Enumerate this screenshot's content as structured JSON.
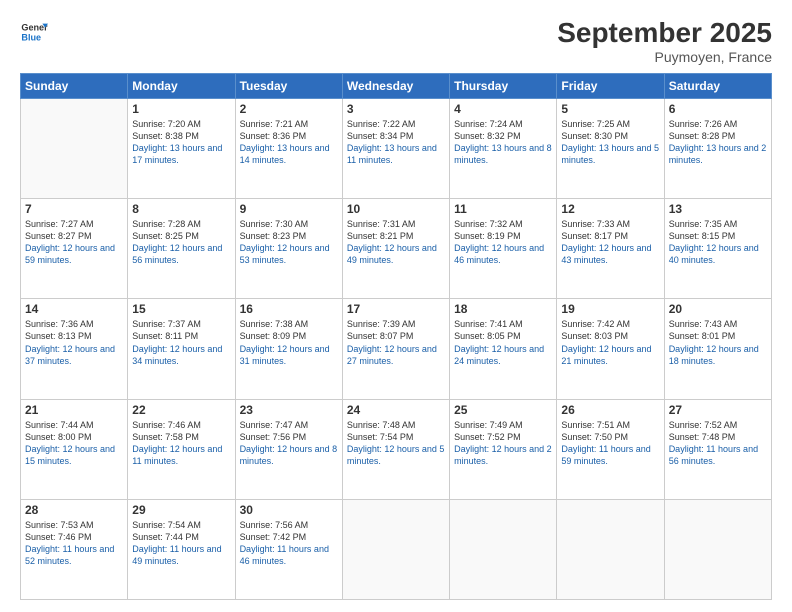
{
  "logo": {
    "line1": "General",
    "line2": "Blue"
  },
  "header": {
    "month": "September 2025",
    "location": "Puymoyen, France"
  },
  "days_of_week": [
    "Sunday",
    "Monday",
    "Tuesday",
    "Wednesday",
    "Thursday",
    "Friday",
    "Saturday"
  ],
  "weeks": [
    [
      {
        "day": "",
        "sunrise": "",
        "sunset": "",
        "daylight": ""
      },
      {
        "day": "1",
        "sunrise": "Sunrise: 7:20 AM",
        "sunset": "Sunset: 8:38 PM",
        "daylight": "Daylight: 13 hours and 17 minutes."
      },
      {
        "day": "2",
        "sunrise": "Sunrise: 7:21 AM",
        "sunset": "Sunset: 8:36 PM",
        "daylight": "Daylight: 13 hours and 14 minutes."
      },
      {
        "day": "3",
        "sunrise": "Sunrise: 7:22 AM",
        "sunset": "Sunset: 8:34 PM",
        "daylight": "Daylight: 13 hours and 11 minutes."
      },
      {
        "day": "4",
        "sunrise": "Sunrise: 7:24 AM",
        "sunset": "Sunset: 8:32 PM",
        "daylight": "Daylight: 13 hours and 8 minutes."
      },
      {
        "day": "5",
        "sunrise": "Sunrise: 7:25 AM",
        "sunset": "Sunset: 8:30 PM",
        "daylight": "Daylight: 13 hours and 5 minutes."
      },
      {
        "day": "6",
        "sunrise": "Sunrise: 7:26 AM",
        "sunset": "Sunset: 8:28 PM",
        "daylight": "Daylight: 13 hours and 2 minutes."
      }
    ],
    [
      {
        "day": "7",
        "sunrise": "Sunrise: 7:27 AM",
        "sunset": "Sunset: 8:27 PM",
        "daylight": "Daylight: 12 hours and 59 minutes."
      },
      {
        "day": "8",
        "sunrise": "Sunrise: 7:28 AM",
        "sunset": "Sunset: 8:25 PM",
        "daylight": "Daylight: 12 hours and 56 minutes."
      },
      {
        "day": "9",
        "sunrise": "Sunrise: 7:30 AM",
        "sunset": "Sunset: 8:23 PM",
        "daylight": "Daylight: 12 hours and 53 minutes."
      },
      {
        "day": "10",
        "sunrise": "Sunrise: 7:31 AM",
        "sunset": "Sunset: 8:21 PM",
        "daylight": "Daylight: 12 hours and 49 minutes."
      },
      {
        "day": "11",
        "sunrise": "Sunrise: 7:32 AM",
        "sunset": "Sunset: 8:19 PM",
        "daylight": "Daylight: 12 hours and 46 minutes."
      },
      {
        "day": "12",
        "sunrise": "Sunrise: 7:33 AM",
        "sunset": "Sunset: 8:17 PM",
        "daylight": "Daylight: 12 hours and 43 minutes."
      },
      {
        "day": "13",
        "sunrise": "Sunrise: 7:35 AM",
        "sunset": "Sunset: 8:15 PM",
        "daylight": "Daylight: 12 hours and 40 minutes."
      }
    ],
    [
      {
        "day": "14",
        "sunrise": "Sunrise: 7:36 AM",
        "sunset": "Sunset: 8:13 PM",
        "daylight": "Daylight: 12 hours and 37 minutes."
      },
      {
        "day": "15",
        "sunrise": "Sunrise: 7:37 AM",
        "sunset": "Sunset: 8:11 PM",
        "daylight": "Daylight: 12 hours and 34 minutes."
      },
      {
        "day": "16",
        "sunrise": "Sunrise: 7:38 AM",
        "sunset": "Sunset: 8:09 PM",
        "daylight": "Daylight: 12 hours and 31 minutes."
      },
      {
        "day": "17",
        "sunrise": "Sunrise: 7:39 AM",
        "sunset": "Sunset: 8:07 PM",
        "daylight": "Daylight: 12 hours and 27 minutes."
      },
      {
        "day": "18",
        "sunrise": "Sunrise: 7:41 AM",
        "sunset": "Sunset: 8:05 PM",
        "daylight": "Daylight: 12 hours and 24 minutes."
      },
      {
        "day": "19",
        "sunrise": "Sunrise: 7:42 AM",
        "sunset": "Sunset: 8:03 PM",
        "daylight": "Daylight: 12 hours and 21 minutes."
      },
      {
        "day": "20",
        "sunrise": "Sunrise: 7:43 AM",
        "sunset": "Sunset: 8:01 PM",
        "daylight": "Daylight: 12 hours and 18 minutes."
      }
    ],
    [
      {
        "day": "21",
        "sunrise": "Sunrise: 7:44 AM",
        "sunset": "Sunset: 8:00 PM",
        "daylight": "Daylight: 12 hours and 15 minutes."
      },
      {
        "day": "22",
        "sunrise": "Sunrise: 7:46 AM",
        "sunset": "Sunset: 7:58 PM",
        "daylight": "Daylight: 12 hours and 11 minutes."
      },
      {
        "day": "23",
        "sunrise": "Sunrise: 7:47 AM",
        "sunset": "Sunset: 7:56 PM",
        "daylight": "Daylight: 12 hours and 8 minutes."
      },
      {
        "day": "24",
        "sunrise": "Sunrise: 7:48 AM",
        "sunset": "Sunset: 7:54 PM",
        "daylight": "Daylight: 12 hours and 5 minutes."
      },
      {
        "day": "25",
        "sunrise": "Sunrise: 7:49 AM",
        "sunset": "Sunset: 7:52 PM",
        "daylight": "Daylight: 12 hours and 2 minutes."
      },
      {
        "day": "26",
        "sunrise": "Sunrise: 7:51 AM",
        "sunset": "Sunset: 7:50 PM",
        "daylight": "Daylight: 11 hours and 59 minutes."
      },
      {
        "day": "27",
        "sunrise": "Sunrise: 7:52 AM",
        "sunset": "Sunset: 7:48 PM",
        "daylight": "Daylight: 11 hours and 56 minutes."
      }
    ],
    [
      {
        "day": "28",
        "sunrise": "Sunrise: 7:53 AM",
        "sunset": "Sunset: 7:46 PM",
        "daylight": "Daylight: 11 hours and 52 minutes."
      },
      {
        "day": "29",
        "sunrise": "Sunrise: 7:54 AM",
        "sunset": "Sunset: 7:44 PM",
        "daylight": "Daylight: 11 hours and 49 minutes."
      },
      {
        "day": "30",
        "sunrise": "Sunrise: 7:56 AM",
        "sunset": "Sunset: 7:42 PM",
        "daylight": "Daylight: 11 hours and 46 minutes."
      },
      {
        "day": "",
        "sunrise": "",
        "sunset": "",
        "daylight": ""
      },
      {
        "day": "",
        "sunrise": "",
        "sunset": "",
        "daylight": ""
      },
      {
        "day": "",
        "sunrise": "",
        "sunset": "",
        "daylight": ""
      },
      {
        "day": "",
        "sunrise": "",
        "sunset": "",
        "daylight": ""
      }
    ]
  ]
}
